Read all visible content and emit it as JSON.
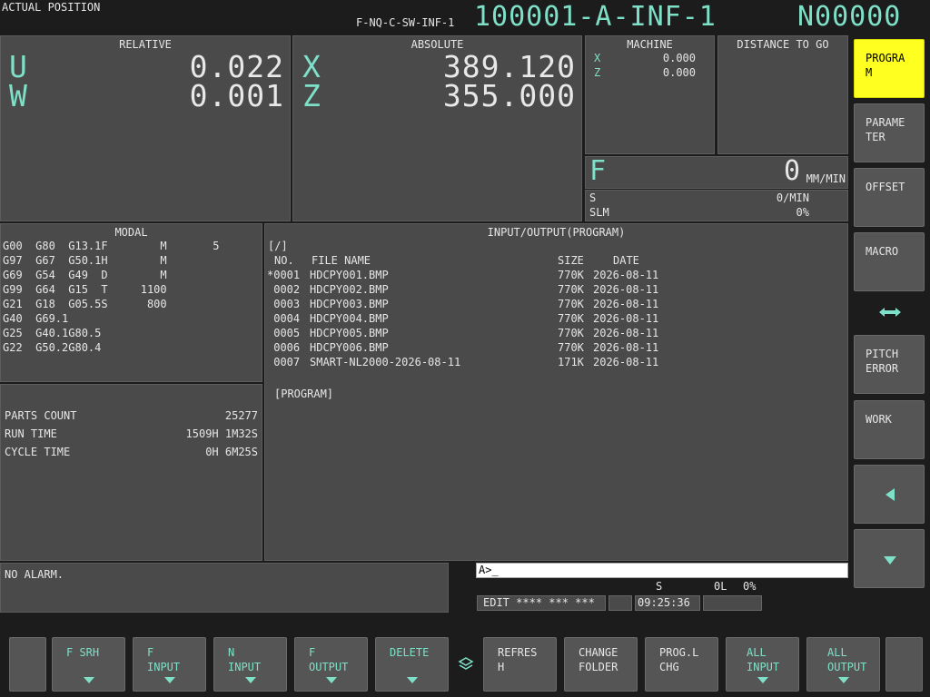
{
  "header": {
    "screen_title": "ACTUAL POSITION",
    "program_file": "F-NQ-C-SW-INF-1",
    "program_name": "100001-A-INF-1",
    "sequence": "N00000"
  },
  "relative": {
    "title": "RELATIVE",
    "axes": [
      {
        "name": "U",
        "value": "0.022"
      },
      {
        "name": "W",
        "value": "0.001"
      }
    ]
  },
  "absolute": {
    "title": "ABSOLUTE",
    "axes": [
      {
        "name": "X",
        "value": "389.120"
      },
      {
        "name": "Z",
        "value": "355.000"
      }
    ]
  },
  "machine": {
    "title": "MACHINE",
    "axes": [
      {
        "name": "X",
        "value": "0.000"
      },
      {
        "name": "Z",
        "value": "0.000"
      }
    ]
  },
  "distance_to_go": {
    "title": "DISTANCE TO GO"
  },
  "feed": {
    "label": "F",
    "value": "0",
    "unit": "MM/MIN",
    "spindle_label": "S",
    "spindle_value": "0/MIN",
    "slm_label": "SLM",
    "slm_value": "0%"
  },
  "modal": {
    "title": "MODAL",
    "rows": [
      "G00  G80  G13.1F        M       5",
      "G97  G67  G50.1H        M",
      "G69  G54  G49  D        M",
      "G99  G64  G15  T     1100",
      "G21  G18  G05.5S      800",
      "G40  G69.1",
      "G25  G40.1G80.5",
      "G22  G50.2G80.4"
    ]
  },
  "counters": {
    "parts_label": "PARTS COUNT",
    "parts_value": "25277",
    "run_label": "RUN TIME",
    "run_value": "1509H 1M32S",
    "cycle_label": "CYCLE TIME",
    "cycle_value": "0H 6M25S"
  },
  "io": {
    "title": "INPUT/OUTPUT(PROGRAM)",
    "path": "[/]",
    "headers": {
      "no": "NO.",
      "file": "FILE NAME",
      "size": "SIZE",
      "date": "DATE"
    },
    "files": [
      {
        "no": "*0001",
        "name": "HDCPY001.BMP",
        "size": "770K",
        "date": "2026-08-11"
      },
      {
        "no": " 0002",
        "name": "HDCPY002.BMP",
        "size": "770K",
        "date": "2026-08-11"
      },
      {
        "no": " 0003",
        "name": "HDCPY003.BMP",
        "size": "770K",
        "date": "2026-08-11"
      },
      {
        "no": " 0004",
        "name": "HDCPY004.BMP",
        "size": "770K",
        "date": "2026-08-11"
      },
      {
        "no": " 0005",
        "name": "HDCPY005.BMP",
        "size": "770K",
        "date": "2026-08-11"
      },
      {
        "no": " 0006",
        "name": "HDCPY006.BMP",
        "size": "770K",
        "date": "2026-08-11"
      },
      {
        "no": " 0007",
        "name": "SMART-NL2000-2026-08-11",
        "size": "171K",
        "date": "2026-08-11"
      }
    ],
    "folder": "[PROGRAM]"
  },
  "alarm": {
    "text": "NO ALARM."
  },
  "input_line": {
    "prompt": "A>_"
  },
  "status": {
    "s_label": "S",
    "l_value": "0L",
    "pct": "0%",
    "mode": "EDIT **** *** ***",
    "clock": "09:25:36"
  },
  "right_keys": [
    {
      "label": "PROGRA\nM",
      "active": true
    },
    {
      "label": "PARAME\nTER"
    },
    {
      "label": "OFFSET"
    },
    {
      "label": "MACRO"
    },
    {
      "label": "PITCH\nERROR"
    },
    {
      "label": "WORK"
    }
  ],
  "softkeys": [
    {
      "label": "F SRH"
    },
    {
      "label": "F\nINPUT"
    },
    {
      "label": "N\nINPUT"
    },
    {
      "label": "F\nOUTPUT"
    },
    {
      "label": "DELETE"
    },
    {
      "label": "REFRES\nH"
    },
    {
      "label": "CHANGE\nFOLDER"
    },
    {
      "label": "PROG.L\nCHG"
    },
    {
      "label": "ALL\nINPUT"
    },
    {
      "label": "ALL\nOUTPUT"
    }
  ],
  "icons": {
    "right_toggle": "double-arrow-icon",
    "bottom_toggle": "stack-icon",
    "left_arrow": "triangle-left-icon",
    "down_arrow": "triangle-down-icon"
  },
  "colors": {
    "accent": "#7fe0c8",
    "active_key": "#ffff20",
    "panel": "#4a4a4a",
    "background": "#1c1c1c"
  }
}
